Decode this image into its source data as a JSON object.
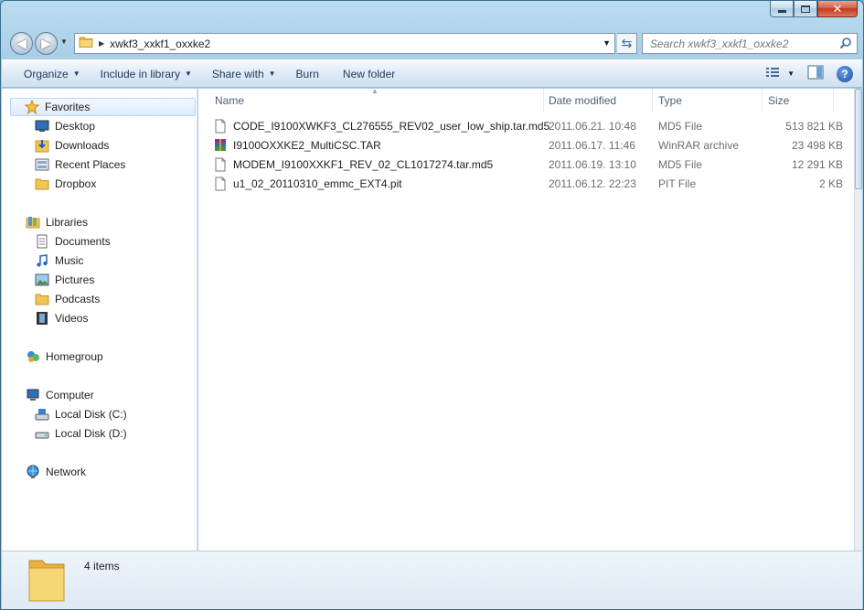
{
  "window": {
    "caption_buttons": [
      "minimize",
      "maximize",
      "close"
    ]
  },
  "address_bar": {
    "breadcrumb": "xwkf3_xxkf1_oxxke2",
    "search_placeholder": "Search xwkf3_xxkf1_oxxke2"
  },
  "toolbar": {
    "organize": "Organize",
    "include_in_library": "Include in library",
    "share_with": "Share with",
    "burn": "Burn",
    "new_folder": "New folder"
  },
  "sidebar": {
    "favorites": {
      "label": "Favorites",
      "items": [
        "Desktop",
        "Downloads",
        "Recent Places",
        "Dropbox"
      ]
    },
    "libraries": {
      "label": "Libraries",
      "items": [
        "Documents",
        "Music",
        "Pictures",
        "Podcasts",
        "Videos"
      ]
    },
    "homegroup": "Homegroup",
    "computer": {
      "label": "Computer",
      "items": [
        "Local Disk (C:)",
        "Local Disk (D:)"
      ]
    },
    "network": "Network"
  },
  "file_list": {
    "columns": [
      "Name",
      "Date modified",
      "Type",
      "Size"
    ],
    "rows": [
      {
        "name": "CODE_I9100XWKF3_CL276555_REV02_user_low_ship.tar.md5",
        "date": "2011.06.21. 10:48",
        "type": "MD5 File",
        "size": "513 821 KB",
        "icon": "generic-file-icon"
      },
      {
        "name": "I9100OXXKE2_MultiCSC.TAR",
        "date": "2011.06.17. 11:46",
        "type": "WinRAR archive",
        "size": "23 498 KB",
        "icon": "winrar-archive-icon"
      },
      {
        "name": "MODEM_I9100XXKF1_REV_02_CL1017274.tar.md5",
        "date": "2011.06.19. 13:10",
        "type": "MD5 File",
        "size": "12 291 KB",
        "icon": "generic-file-icon"
      },
      {
        "name": "u1_02_20110310_emmc_EXT4.pit",
        "date": "2011.06.12. 22:23",
        "type": "PIT File",
        "size": "2 KB",
        "icon": "generic-file-icon"
      }
    ]
  },
  "details_pane": {
    "item_count": "4 items"
  },
  "colors": {
    "accent": "#3b6ea5",
    "folder": "#f0c455",
    "selection": "#dcebfb"
  }
}
